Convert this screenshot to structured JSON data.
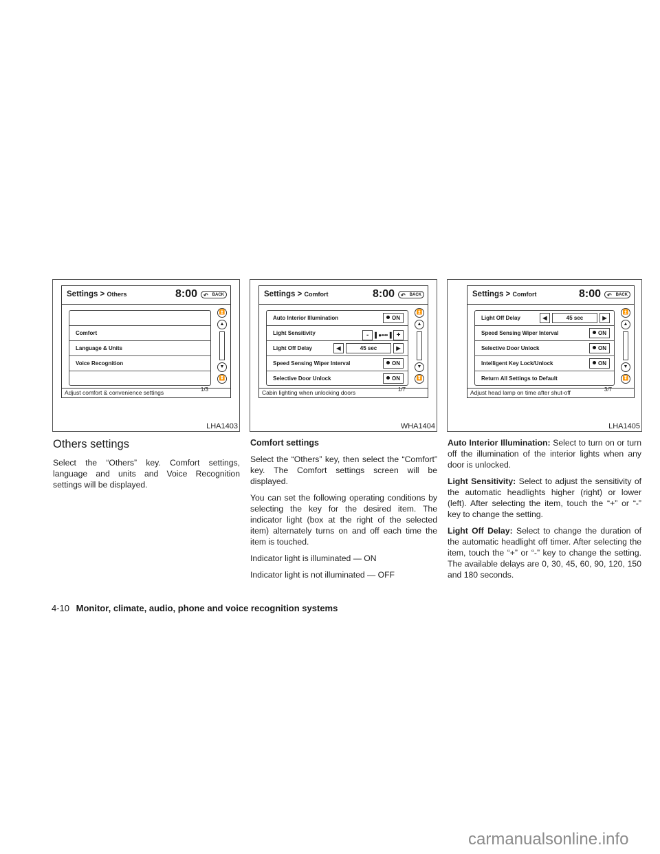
{
  "figures": [
    {
      "code": "LHA1403",
      "screen": {
        "breadcrumb_root": "Settings >",
        "breadcrumb_sub": "Others",
        "clock": "8:00",
        "back_label": "BACK",
        "rows": [
          "",
          "Comfort",
          "Language & Units",
          "Voice Recognition",
          ""
        ],
        "page_indicator": "1/3",
        "status": "Adjust comfort & convenience settings"
      }
    },
    {
      "code": "WHA1404",
      "screen": {
        "breadcrumb_root": "Settings >",
        "breadcrumb_sub": "Comfort",
        "clock": "8:00",
        "back_label": "BACK",
        "rows": [
          {
            "label": "Auto Interior Illumination",
            "control": "on",
            "value": "ON"
          },
          {
            "label": "Light Sensitivity",
            "control": "slider",
            "minus": "-",
            "plus": "+",
            "level": 1,
            "levels": 5
          },
          {
            "label": "Light Off Delay",
            "control": "delay",
            "value": "45 sec"
          },
          {
            "label": "Speed Sensing Wiper Interval",
            "control": "on",
            "value": "ON"
          },
          {
            "label": "Selective Door Unlock",
            "control": "on",
            "value": "ON"
          }
        ],
        "page_indicator": "1/7",
        "status": "Cabin lighting when unlocking doors"
      }
    },
    {
      "code": "LHA1405",
      "screen": {
        "breadcrumb_root": "Settings >",
        "breadcrumb_sub": "Comfort",
        "clock": "8:00",
        "back_label": "BACK",
        "rows": [
          {
            "label": "Light Off Delay",
            "control": "delay",
            "value": "45 sec"
          },
          {
            "label": "Speed Sensing Wiper Interval",
            "control": "on",
            "value": "ON"
          },
          {
            "label": "Selective Door Unlock",
            "control": "on",
            "value": "ON"
          },
          {
            "label": "Intelligent Key Lock/Unlock",
            "control": "on",
            "value": "ON"
          },
          {
            "label": "Return All Settings to Default",
            "control": "none"
          }
        ],
        "page_indicator": "3/7",
        "status": "Adjust head lamp on time after shut-off"
      }
    }
  ],
  "column1": {
    "heading": "Others settings",
    "paragraphs": [
      "Select the “Others” key. Comfort settings, language and units and Voice Recognition settings will be displayed."
    ]
  },
  "column2": {
    "heading": "Comfort settings",
    "paragraphs": [
      "Select the “Others” key, then select the “Comfort” key. The Comfort settings screen will be displayed.",
      "You can set the following operating conditions by selecting the key for the desired item. The indicator light (box at the right of the selected item) alternately turns on and off each time the item is touched.",
      "Indicator light is illuminated — ON",
      "Indicator light is not illuminated — OFF"
    ]
  },
  "column3": {
    "items": [
      {
        "term": "Auto Interior Illumination:",
        "text": " Select to turn on or turn off the illumination of the interior lights when any door is unlocked."
      },
      {
        "term": "Light Sensitivity:",
        "text": " Select to adjust the sensitivity of the automatic headlights higher (right) or lower (left). After selecting the item, touch the “+” or “-” key to change the setting."
      },
      {
        "term": "Light Off Delay:",
        "text": " Select to change the duration of the automatic headlight off timer. After selecting the item, touch the “+” or “-” key to change the setting. The available delays are 0, 30, 45, 60, 90, 120, 150 and 180 seconds."
      }
    ]
  },
  "footer": {
    "page_number": "4-10",
    "section_title": "Monitor, climate, audio, phone and voice recognition systems"
  },
  "watermark": "carmanualsonline.info",
  "icons": {
    "back": "back-arrow-icon",
    "scroll_top": "double-chevron-up-icon",
    "scroll_up": "chevron-up-icon",
    "scroll_down": "chevron-down-icon",
    "scroll_bottom": "double-chevron-down-icon",
    "left_arrow": "triangle-left-icon",
    "right_arrow": "triangle-right-icon"
  }
}
